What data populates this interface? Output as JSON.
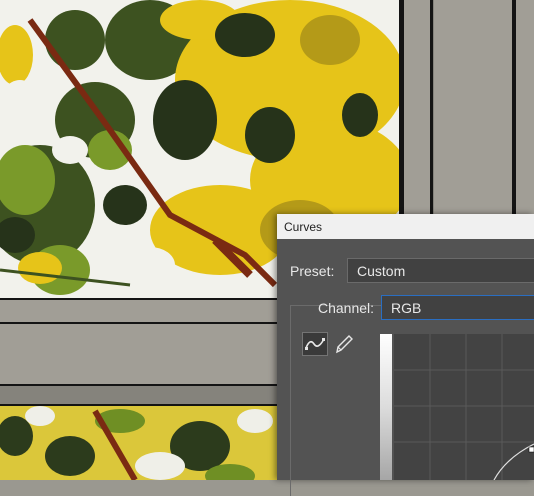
{
  "dialog": {
    "title": "Curves",
    "preset_label": "Preset:",
    "preset_value": "Custom",
    "channel_label": "Channel:",
    "channel_value": "RGB"
  },
  "tools": {
    "curve_tool_icon": "curve-icon",
    "pencil_tool_icon": "pencil-icon"
  },
  "colors": {
    "dialog_bg": "#535353",
    "titlebar_bg": "#f0f0f0",
    "accent_focus": "#2a6ec2",
    "leaf_yellow": "#e4c21a",
    "leaf_dark": "#2a3a1a"
  }
}
